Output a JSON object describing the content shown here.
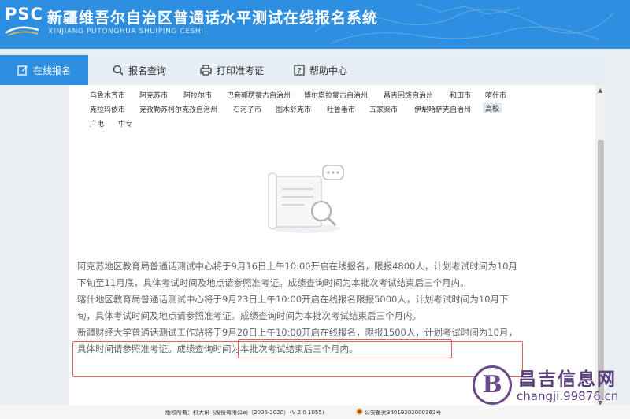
{
  "header": {
    "logo_text": "PSC",
    "title": "新疆维吾尔自治区普通话水平测试在线报名系统",
    "subtitle": "XINJIANG PUTONGHUA SHUIPING CESHI",
    "bg_color": "#2e8fe0"
  },
  "nav": {
    "items": [
      {
        "label": "在线报名",
        "icon": "edit-icon",
        "active": true
      },
      {
        "label": "报名查询",
        "icon": "search-icon",
        "active": false
      },
      {
        "label": "打印准考证",
        "icon": "printer-icon",
        "active": false
      },
      {
        "label": "帮助中心",
        "icon": "help-icon",
        "active": false
      }
    ]
  },
  "regions": {
    "row1": [
      "乌鲁木齐市",
      "阿克苏市",
      "阿拉尔市",
      "巴音郭楞蒙古自治州",
      "博尔塔拉蒙古自治州",
      "昌吉回族自治州",
      "和田市",
      "喀什市"
    ],
    "row2": [
      "克拉玛依市",
      "克孜勒苏柯尔克孜自治州",
      "石河子市",
      "图木舒克市",
      "吐鲁番市",
      "五家渠市",
      "伊犁哈萨克自治州",
      "高校"
    ],
    "row3": [
      "广电",
      "中专"
    ],
    "selected": "高校"
  },
  "notices": {
    "n1": "阿克苏地区教育局普通话测试中心将于9月16日上午10:00开启在线报名，限报4800人，计划考试时间为10月下旬至11月底，具体考试时间及地点请参照准考证。成绩查询时间为本批次考试结束后三个月内。",
    "n2": "喀什地区教育局普通话测试中心将于9月23日上午10:00开启在线报名限报5000人，计划考试时间为10月下旬，具体考试时间及地点请参照准考证。成绩查询时间为本批次考试结束后三个月内。",
    "n3": "新疆财经大学普通话测试工作站将于9月20日上午10:00开启在线报名，限报1500人，计划考试时间为10月，具体时间请参照准考证。成绩查询时间为本批次考试结束后三个月内。"
  },
  "footer": {
    "copyright": "版权所有：科大讯飞股份有限公司（2006-2020）（V 2.0.1055）",
    "beian": "公安备案34019202000362号"
  },
  "watermark": {
    "logo": "B",
    "name": "昌吉信息网",
    "url": "changji.99876.cn"
  }
}
